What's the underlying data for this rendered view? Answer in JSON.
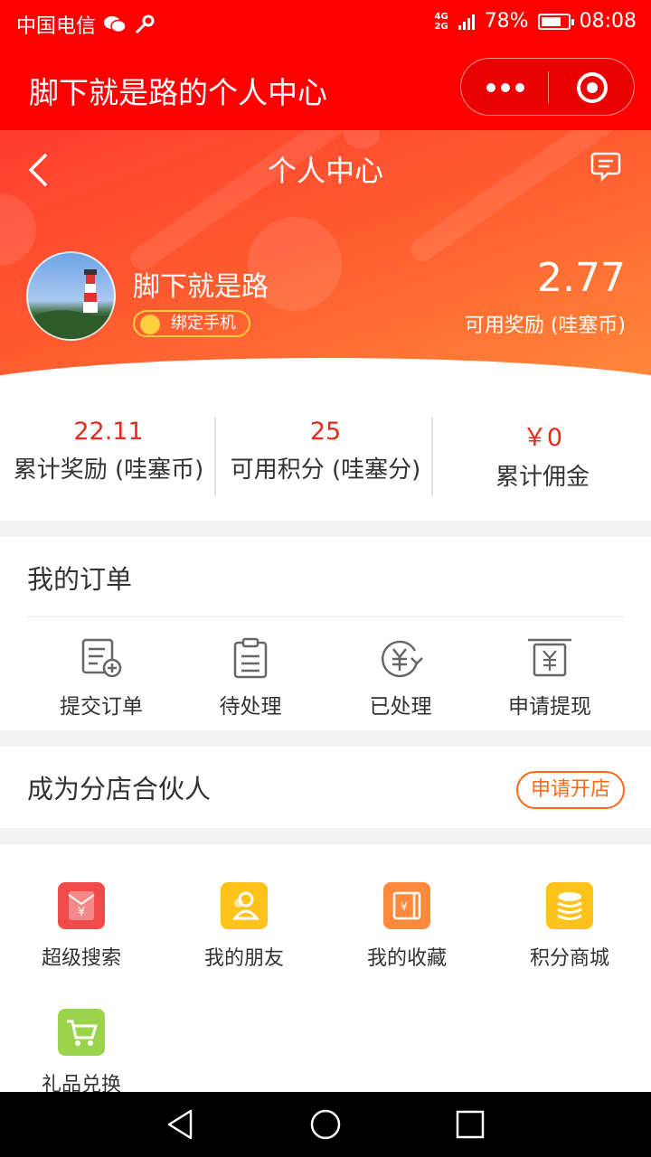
{
  "status_bar": {
    "carrier": "中国电信",
    "network": "4G\n2G",
    "battery": "78%",
    "battery_level": 0.78,
    "time": "08:08"
  },
  "mini_program": {
    "title": "脚下就是路的个人中心"
  },
  "header": {
    "page_title": "个人中心"
  },
  "profile": {
    "name": "脚下就是路",
    "bind_phone_label": "绑定手机",
    "balance_value": "2.77",
    "balance_label": "可用奖励 (哇塞币)"
  },
  "stats": [
    {
      "value": "22.11",
      "label": "累计奖励 (哇塞币)"
    },
    {
      "value": "25",
      "label": "可用积分 (哇塞分)"
    },
    {
      "value": "￥0",
      "label": "累计佣金"
    }
  ],
  "orders": {
    "title": "我的订单",
    "items": [
      {
        "label": "提交订单",
        "icon": "submit-order-icon"
      },
      {
        "label": "待处理",
        "icon": "clipboard-icon"
      },
      {
        "label": "已处理",
        "icon": "yuan-refresh-icon"
      },
      {
        "label": "申请提现",
        "icon": "withdraw-icon"
      }
    ]
  },
  "partner": {
    "title": "成为分店合伙人",
    "apply_label": "申请开店"
  },
  "features": [
    {
      "label": "超级搜索",
      "icon": "red-envelope-icon",
      "color": "#f04a4a"
    },
    {
      "label": "我的朋友",
      "icon": "friends-icon",
      "color": "#ffc21a"
    },
    {
      "label": "我的收藏",
      "icon": "favorites-icon",
      "color": "#ff8a3d"
    },
    {
      "label": "积分商城",
      "icon": "coins-icon",
      "color": "#ffc21a"
    },
    {
      "label": "礼品兑换",
      "icon": "cart-icon",
      "color": "#9bd34a"
    }
  ]
}
